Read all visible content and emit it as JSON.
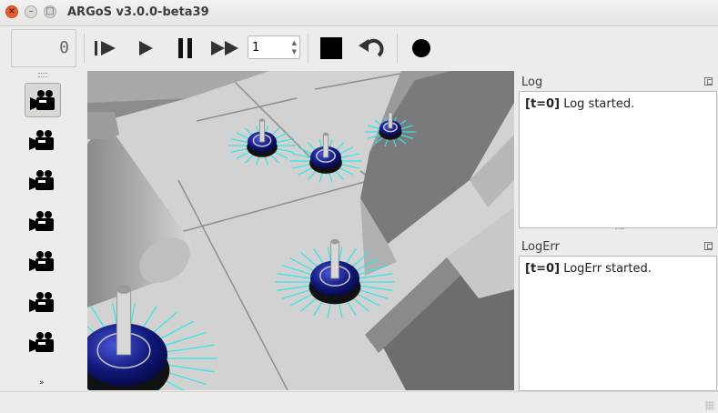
{
  "window": {
    "title": "ARGoS v3.0.0-beta39"
  },
  "toolbar": {
    "step_counter": "0",
    "step_spin_value": "1",
    "buttons": [
      {
        "name": "step-icon"
      },
      {
        "name": "play-icon"
      },
      {
        "name": "pause-icon"
      },
      {
        "name": "fast-forward-icon"
      },
      {
        "name": "stop-icon"
      },
      {
        "name": "reset-icon"
      },
      {
        "name": "record-icon"
      }
    ]
  },
  "cameras": {
    "count": 7,
    "active_index": 0,
    "icon": "video-camera-icon"
  },
  "log": {
    "title": "Log",
    "entries": [
      {
        "time": "[t=0]",
        "message": "Log started."
      }
    ]
  },
  "logerr": {
    "title": "LogErr",
    "entries": [
      {
        "time": "[t=0]",
        "message": "LogErr started."
      }
    ]
  },
  "colors": {
    "robot_body": "#0d1470",
    "range_sensor": "#2fe5e8",
    "floor": "#d4d4d4"
  }
}
